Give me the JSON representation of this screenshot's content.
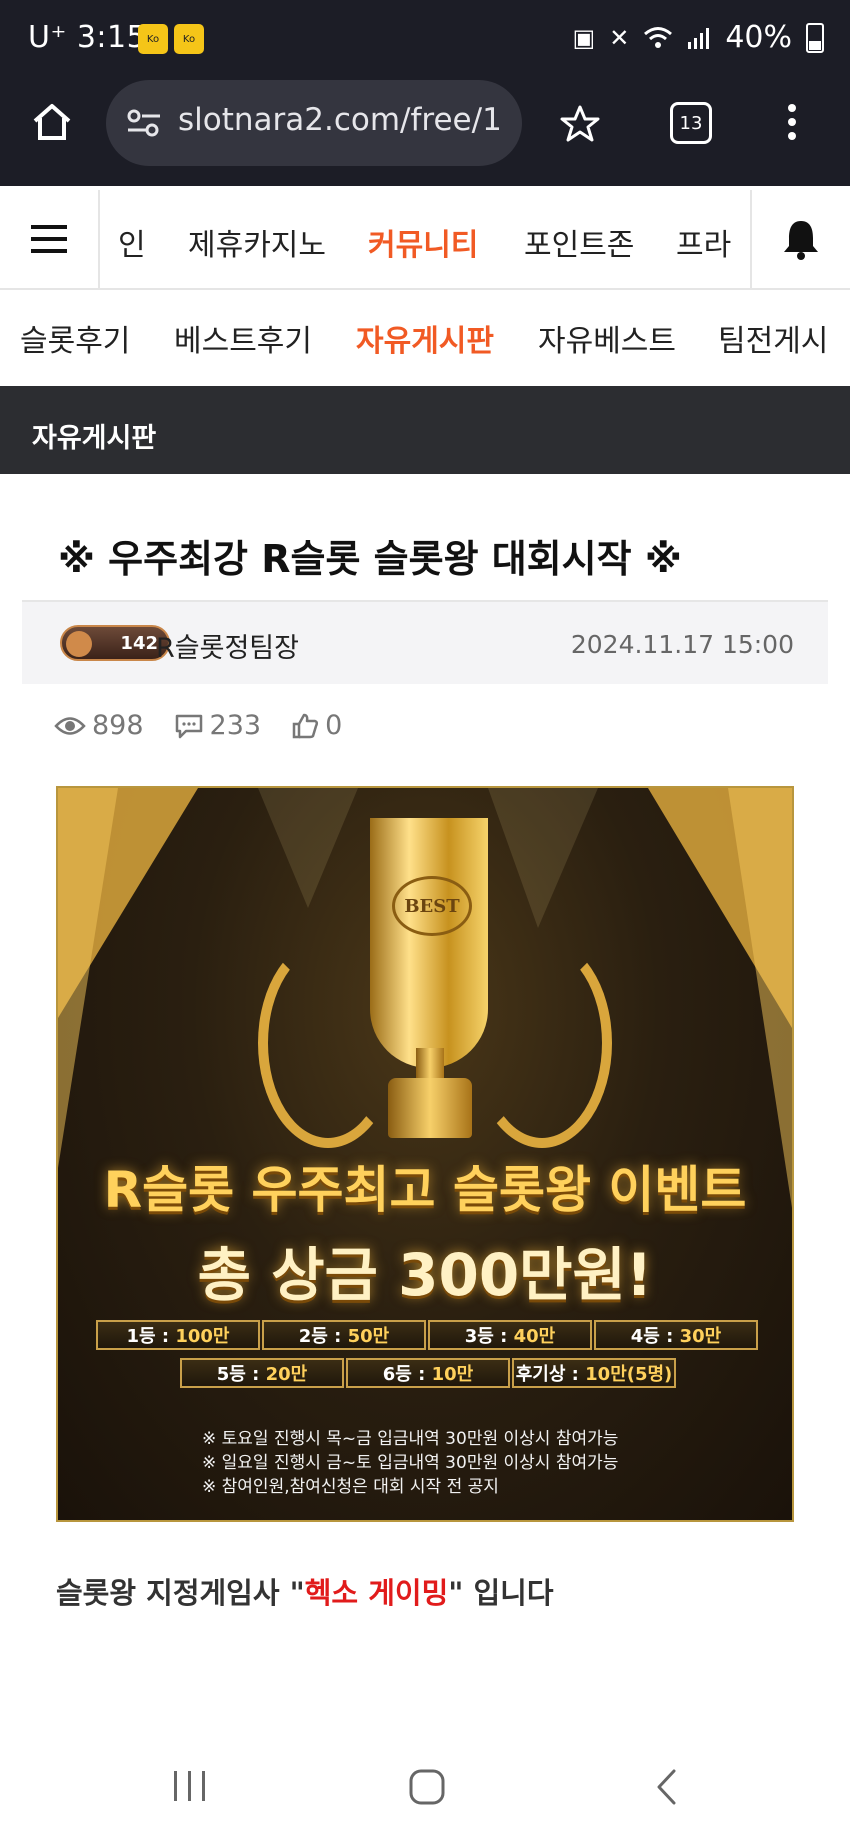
{
  "status_bar": {
    "time": "U⁺ 3:15",
    "battery": "40%"
  },
  "browser": {
    "url": "slotnara2.com/free/1",
    "tab_count": "13"
  },
  "nav_main": {
    "items": [
      "인",
      "제휴카지노",
      "커뮤니티",
      "포인트존",
      "프라"
    ],
    "active": "커뮤니티"
  },
  "nav_sub": {
    "items": [
      "슬롯후기",
      "베스트후기",
      "자유게시판",
      "자유베스트",
      "팀전게시"
    ],
    "active": "자유게시판"
  },
  "board": {
    "name": "자유게시판"
  },
  "post": {
    "title": "※ 우주최강 R슬롯 슬롯왕 대회시작 ※",
    "level": "142",
    "author": "R슬롯정팀장",
    "date": "2024.11.17 15:00",
    "views": "898",
    "comments": "233",
    "likes": "0",
    "body_prefix": "슬롯왕 지정게임사 \"",
    "body_highlight": "헥소 게이밍",
    "body_suffix": "\" 입니다"
  },
  "banner": {
    "trophy_label": "BEST",
    "headline": "R슬롯 우주최고 슬롯왕 이벤트",
    "subheadline": "총 상금 300만원!",
    "prizes_row1": [
      {
        "rank": "1등 :",
        "amount": "100만"
      },
      {
        "rank": "2등 :",
        "amount": "50만"
      },
      {
        "rank": "3등 :",
        "amount": "40만"
      },
      {
        "rank": "4등 :",
        "amount": "30만"
      }
    ],
    "prizes_row2": [
      {
        "rank": "5등 :",
        "amount": "20만"
      },
      {
        "rank": "6등 :",
        "amount": "10만"
      },
      {
        "rank": "후기상 :",
        "amount": "10만(5명)"
      }
    ],
    "notes": [
      "※ 토요일 진행시 목~금 입금내역 30만원 이상시 참여가능",
      "※ 일요일 진행시 금~토 입금내역 30만원 이상시 참여가능",
      "※ 참여인원,참여신청은 대회 시작 전 공지"
    ]
  },
  "colors": {
    "accent": "#f15a24",
    "highlight_red": "#e11b1b",
    "dark_bar": "#2c2d31",
    "status_bg": "#1c1d26",
    "gold": "#ffd15c"
  }
}
